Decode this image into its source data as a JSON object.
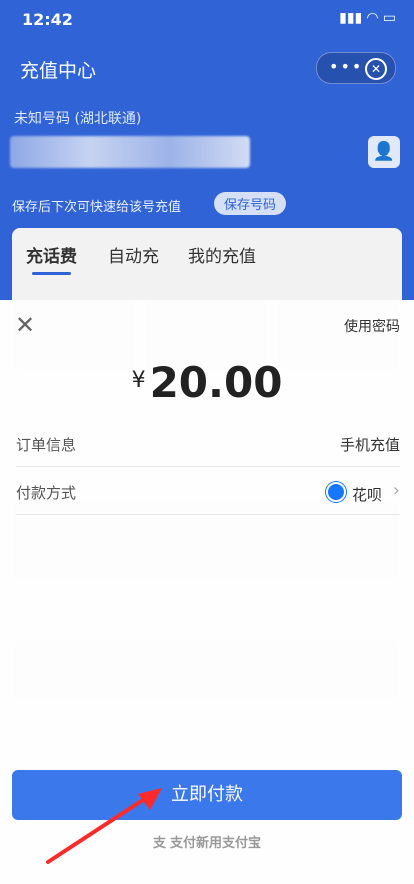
{
  "status_bar": {
    "time": "12:42"
  },
  "header": {
    "title": "充值中心",
    "capsule_dots": "•••",
    "number_label": "未知号码 (湖北联通)",
    "save_hint": "保存后下次可快速给该号充值",
    "save_button": "保存号码"
  },
  "tabs": [
    {
      "label": "充话费",
      "active": true
    },
    {
      "label": "自动充",
      "active": false
    },
    {
      "label": "我的充值",
      "active": false
    }
  ],
  "sheet": {
    "use_password": "使用密码",
    "currency": "¥",
    "amount": "20.00",
    "order_label": "订单信息",
    "order_value": "手机充值",
    "payment_label": "付款方式",
    "payment_value": "花呗",
    "pay_button": "立即付款",
    "footer": "支付新用支付宝"
  },
  "colors": {
    "brand": "#2f63d6",
    "pay_button": "#3a78ec",
    "arrow": "#ff2b2b"
  }
}
